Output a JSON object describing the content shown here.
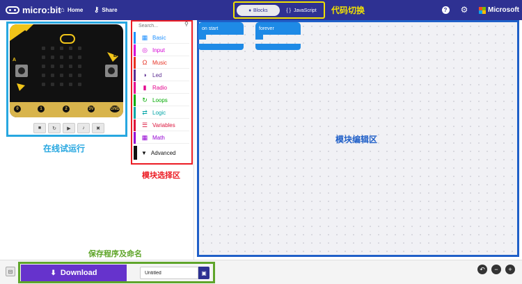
{
  "header": {
    "logo_text": "micro:bit",
    "home_label": "Home",
    "share_label": "Share",
    "blocks_label": "Blocks",
    "javascript_label": "JavaScript",
    "microsoft_label": "Microsoft",
    "help_icon": "question-icon",
    "settings_icon": "gear-icon"
  },
  "annotations": {
    "code_switch": "代码切换",
    "online_run": "在线试运行",
    "block_select": "模块选择区",
    "block_edit": "模块编辑区",
    "save_name": "保存程序及命名"
  },
  "toolbox": {
    "search_placeholder": "Search...",
    "categories": [
      {
        "label": "Basic",
        "color": "#1E90FF",
        "icon": "grid-icon"
      },
      {
        "label": "Input",
        "color": "#D400D4",
        "icon": "target-icon"
      },
      {
        "label": "Music",
        "color": "#E63022",
        "icon": "headphones-icon"
      },
      {
        "label": "Led",
        "color": "#5C2D91",
        "icon": "toggle-icon"
      },
      {
        "label": "Radio",
        "color": "#E3008C",
        "icon": "signal-bars-icon"
      },
      {
        "label": "Loops",
        "color": "#00AA00",
        "icon": "refresh-icon"
      },
      {
        "label": "Logic",
        "color": "#00A4A6",
        "icon": "shuffle-icon"
      },
      {
        "label": "Variables",
        "color": "#DC143C",
        "icon": "list-icon"
      },
      {
        "label": "Math",
        "color": "#9400D3",
        "icon": "calculator-icon"
      }
    ],
    "advanced_label": "Advanced"
  },
  "simulator": {
    "pins": [
      "0",
      "1",
      "2",
      "3V",
      "GND"
    ],
    "button_a": "A",
    "button_b": "B",
    "controls": [
      "stop-icon",
      "restart-icon",
      "slowmo-icon",
      "mute-icon",
      "fullscreen-icon"
    ]
  },
  "workspace": {
    "on_start_label": "on start",
    "forever_label": "forever"
  },
  "bottom": {
    "download_label": "Download",
    "project_name": "Untitled"
  },
  "colors": {
    "header": "#2E3192",
    "download": "#6633CC",
    "block": "#1E8AE6"
  }
}
